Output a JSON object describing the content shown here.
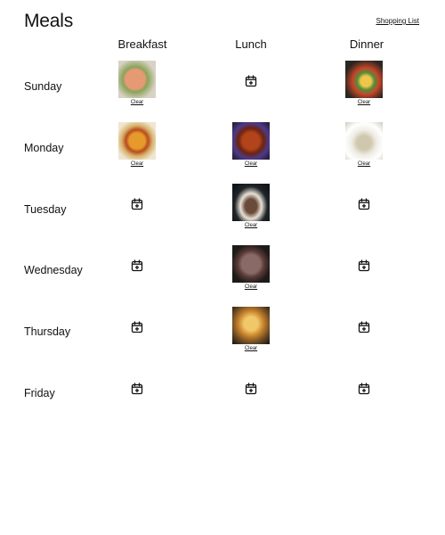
{
  "header": {
    "title": "Meals",
    "shopping_list_label": "Shopping List"
  },
  "columns": [
    "Breakfast",
    "Lunch",
    "Dinner"
  ],
  "clear_label": "Clear",
  "add_icon": "calendar-plus-icon",
  "days": [
    {
      "name": "Sunday",
      "meals": [
        "salmon-herb-photo",
        null,
        "veggie-salad-photo"
      ]
    },
    {
      "name": "Monday",
      "meals": [
        "stew-bowl-photo",
        "glazed-ribs-photo",
        "creamy-soup-photo"
      ]
    },
    {
      "name": "Tuesday",
      "meals": [
        null,
        "steak-plate-photo",
        null
      ]
    },
    {
      "name": "Wednesday",
      "meals": [
        null,
        "sliced-beef-photo",
        null
      ]
    },
    {
      "name": "Thursday",
      "meals": [
        null,
        "roast-chicken-photo",
        null
      ]
    },
    {
      "name": "Friday",
      "meals": [
        null,
        null,
        null
      ]
    }
  ]
}
